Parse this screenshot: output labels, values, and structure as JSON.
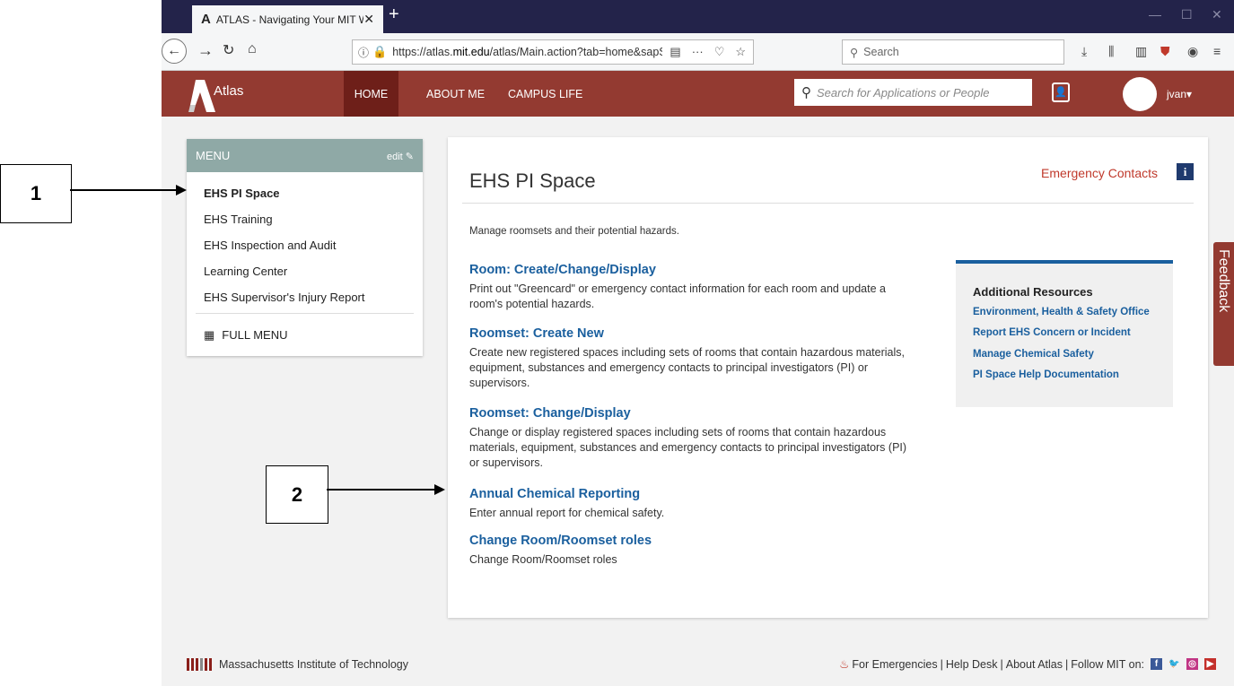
{
  "browser": {
    "tab_title": "ATLAS - Navigating Your MIT W",
    "url_prefix": "https://atlas.",
    "url_domain": "mit.edu",
    "url_rest": "/atlas/Main.action?tab=home&sapSyst",
    "search_placeholder": "Search"
  },
  "header": {
    "brand": "Atlas",
    "nav": [
      "HOME",
      "ABOUT ME",
      "CAMPUS LIFE"
    ],
    "search_placeholder": "Search for Applications or People",
    "user": "jvan▾"
  },
  "menu": {
    "title": "MENU",
    "edit_label": "edit",
    "items": [
      "EHS PI Space",
      "EHS Training",
      "EHS Inspection and Audit",
      "Learning Center",
      "EHS Supervisor's Injury Report"
    ],
    "full_menu": "FULL MENU"
  },
  "content": {
    "title": "EHS PI Space",
    "emergency_contacts": "Emergency Contacts",
    "description": "Manage roomsets and their potential hazards.",
    "links": [
      {
        "title": "Room: Create/Change/Display",
        "desc": "Print out \"Greencard\" or emergency contact information for each room and update a room's potential hazards."
      },
      {
        "title": "Roomset: Create New",
        "desc": "Create new registered spaces including sets of rooms that contain hazardous materials, equipment, substances and emergency contacts to principal investigators (PI) or supervisors."
      },
      {
        "title": "Roomset: Change/Display",
        "desc": "Change or display registered spaces including sets of rooms that contain hazardous materials, equipment, substances and emergency contacts to principal investigators (PI) or supervisors."
      },
      {
        "title": "Annual Chemical Reporting",
        "desc": "Enter annual report for chemical safety."
      },
      {
        "title": "Change Room/Roomset roles",
        "desc": "Change Room/Roomset roles"
      }
    ]
  },
  "resources": {
    "title": "Additional Resources",
    "links": [
      "Environment, Health & Safety Office",
      "Report EHS Concern or Incident",
      "Manage Chemical Safety",
      "PI Space Help Documentation"
    ]
  },
  "feedback_label": "Feedback",
  "footer": {
    "institute": "Massachusetts Institute of Technology",
    "emergencies": "For Emergencies",
    "help_desk": "Help Desk",
    "about": "About Atlas",
    "follow": "Follow MIT on:",
    "separator": "|"
  },
  "callouts": [
    "1",
    "2"
  ],
  "colors": {
    "header": "#933a31",
    "menu_head": "#8fa9a6",
    "link": "#1a5f9e",
    "emergency": "#c0392b"
  }
}
